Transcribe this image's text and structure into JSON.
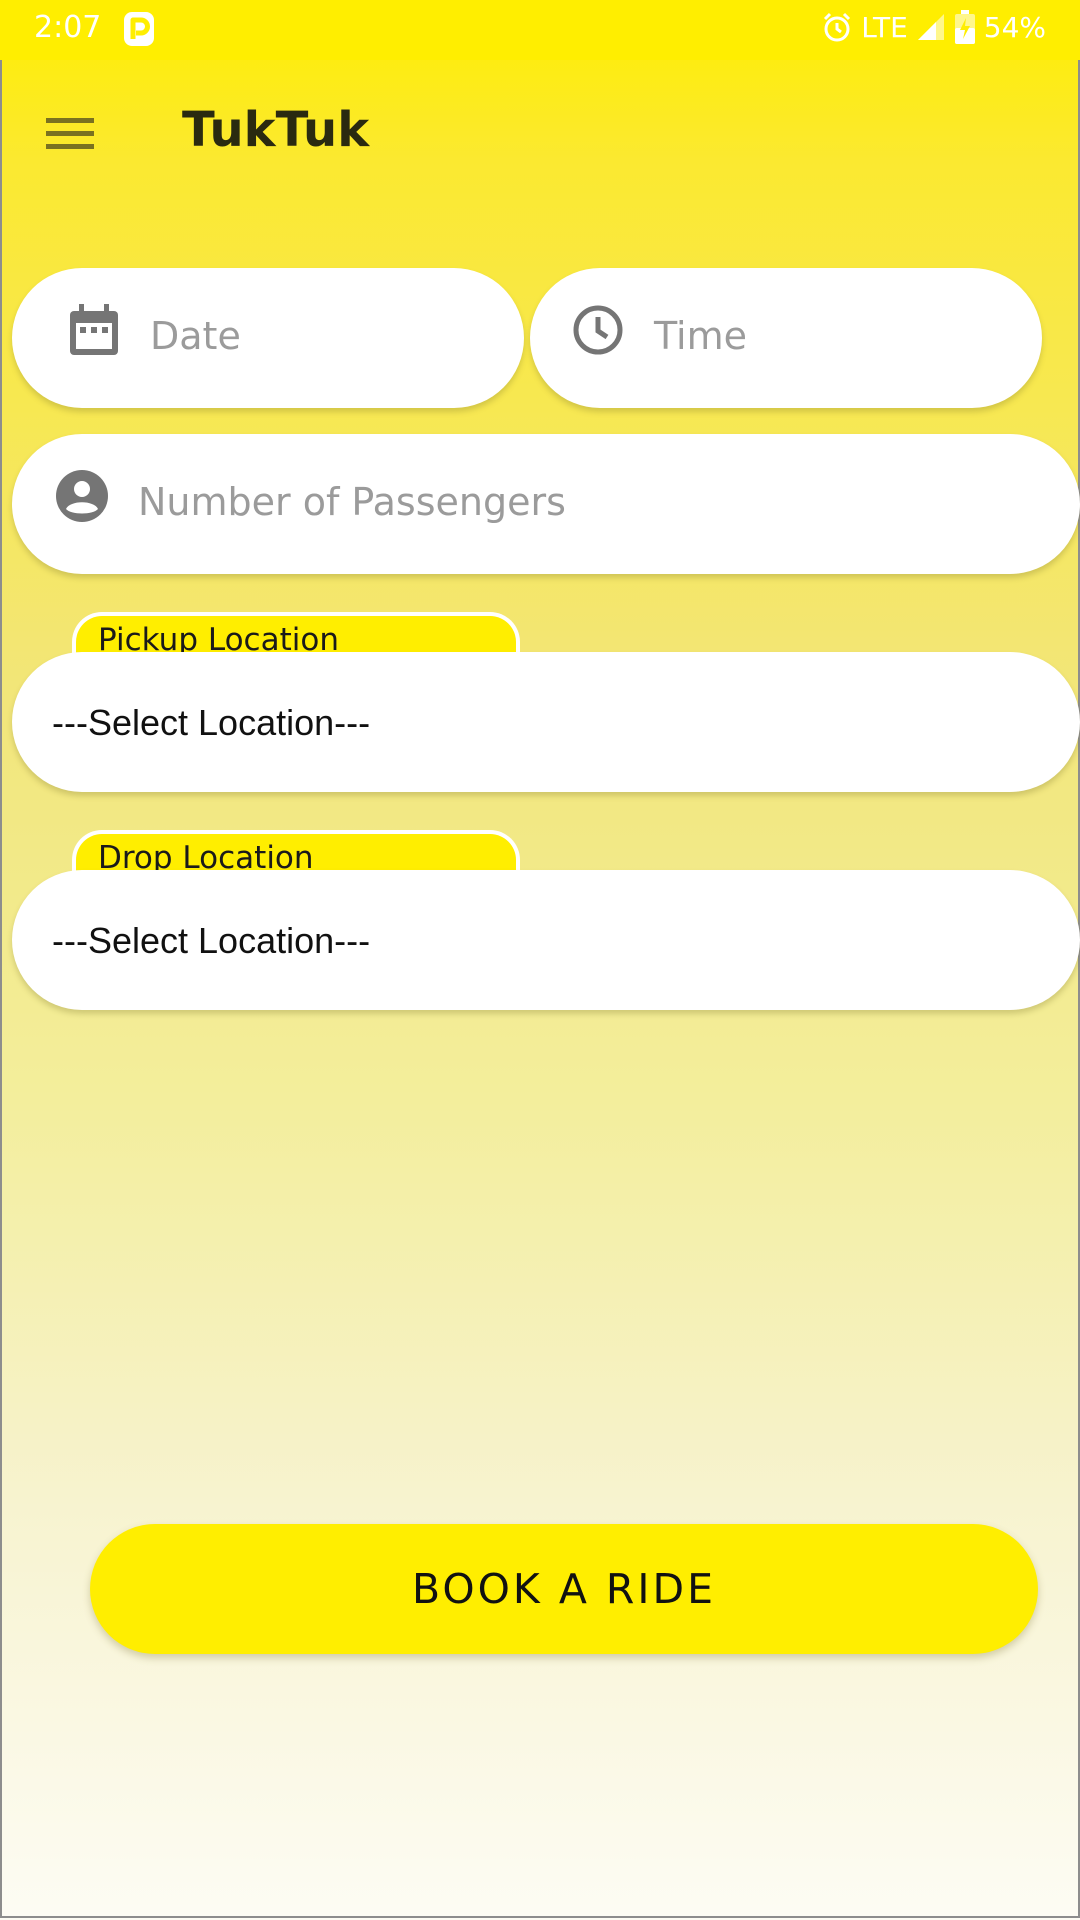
{
  "status_bar": {
    "time": "2:07",
    "network": "LTE",
    "battery": "54%",
    "icons": [
      "parking-app-icon",
      "alarm-icon",
      "signal-icon",
      "battery-charging-icon"
    ]
  },
  "app_bar": {
    "title": "TukTuk",
    "menu_icon": "menu-icon"
  },
  "form": {
    "date_placeholder": "Date",
    "time_placeholder": "Time",
    "passengers_placeholder": "Number of Passengers",
    "pickup_label": "Pickup Location",
    "pickup_value": "---Select Location---",
    "drop_label": "Drop Location",
    "drop_value": "---Select Location---"
  },
  "actions": {
    "book_label": "BOOK A RIDE"
  },
  "colors": {
    "accent": "#ffee00",
    "placeholder": "#9b9b9b",
    "icon_gray": "#757575"
  }
}
